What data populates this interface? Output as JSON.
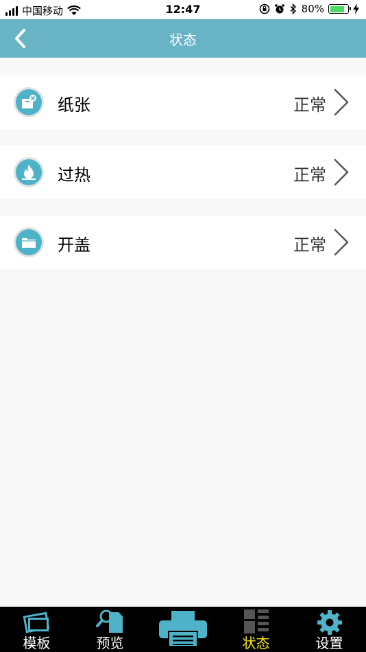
{
  "status_bar": {
    "carrier": "中国移动",
    "time": "12:47",
    "battery": "80%",
    "battery_level": 0.8
  },
  "nav": {
    "title": "状态"
  },
  "rows": [
    {
      "label": "纸张",
      "value": "正常",
      "icon": "paper-icon"
    },
    {
      "label": "过热",
      "value": "正常",
      "icon": "flame-icon"
    },
    {
      "label": "开盖",
      "value": "正常",
      "icon": "folder-icon"
    }
  ],
  "tabs": [
    {
      "label": "模板",
      "icon": "template-icon",
      "active": false
    },
    {
      "label": "预览",
      "icon": "preview-icon",
      "active": false
    },
    {
      "label": "",
      "icon": "printer-icon",
      "active": false
    },
    {
      "label": "状态",
      "icon": "status-icon",
      "active": true
    },
    {
      "label": "设置",
      "icon": "gear-icon",
      "active": false
    }
  ],
  "colors": {
    "nav_bg": "#68b4c6",
    "icon_bg": "#4eb3c8",
    "tab_active": "#f5e619",
    "tab_bar_bg": "#000000"
  }
}
